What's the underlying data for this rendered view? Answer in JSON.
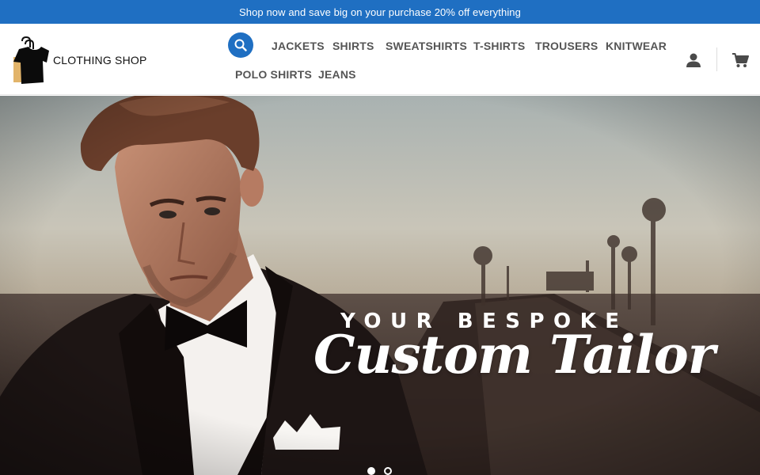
{
  "promo": {
    "text": "Shop now and save big on your purchase 20% off everything"
  },
  "brand": {
    "name": "CLOTHING SHOP"
  },
  "colors": {
    "accent": "#1f6fc2"
  },
  "nav": {
    "items": [
      {
        "label": "JACKETS"
      },
      {
        "label": "SHIRTS"
      },
      {
        "label": "SWEATSHIRTS"
      },
      {
        "label": "T-SHIRTS"
      },
      {
        "label": "TROUSERS"
      },
      {
        "label": "KNITWEAR"
      },
      {
        "label": "POLO SHIRTS"
      },
      {
        "label": "JEANS"
      }
    ]
  },
  "icons": {
    "search": "search-icon",
    "account": "user-icon",
    "cart": "cart-icon",
    "bag": "shopping-bag-icon"
  },
  "hero": {
    "line1": "YOUR BESPOKE",
    "line2": "Custom Tailor",
    "slide_count": 2,
    "active_slide": 1
  }
}
